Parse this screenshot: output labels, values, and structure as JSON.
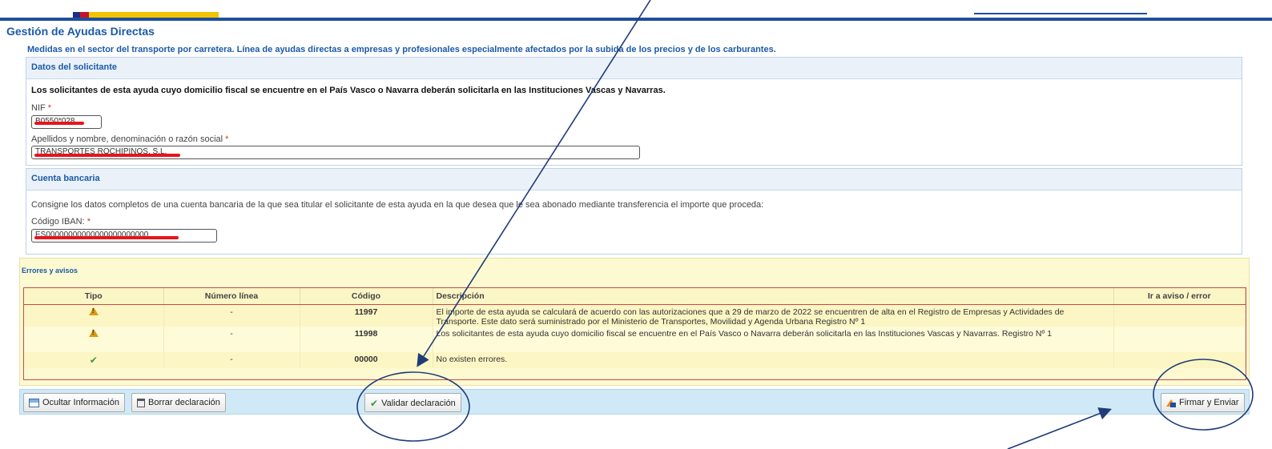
{
  "header": {
    "page_title": "Gestión de Ayudas Directas",
    "subtitle": "Medidas en el sector del transporte por carretera. Línea de ayudas directas a empresas y profesionales especialmente afectados por la subida de los precios y de los carburantes."
  },
  "solicitante": {
    "title": "Datos del solicitante",
    "note": "Los solicitantes de esta ayuda cuyo domicilio fiscal se encuentre en el País Vasco o Navarra deberán solicitarla en las Instituciones Vascas y Navarras.",
    "nif_label": "NIF",
    "nif_value": "B0550*028",
    "name_label": "Apellidos y nombre, denominación o razón social",
    "name_value": "TRANSPORTES ROCHIPINOS, S.L.",
    "required_mark": "*"
  },
  "cuenta": {
    "title": "Cuenta bancaria",
    "note": "Consigne los datos completos de una cuenta bancaria de la que sea titular el solicitante de esta ayuda en la que desea que le sea abonado mediante transferencia el importe que proceda:",
    "iban_label": "Código IBAN:",
    "iban_value": "ES00000000000000000000000",
    "required_mark": "*"
  },
  "errores": {
    "title": "Errores y avisos",
    "columns": [
      "Tipo",
      "Número línea",
      "Código",
      "Descripción",
      "Ir a aviso / error"
    ],
    "rows": [
      {
        "tipo_icon": "warning-icon",
        "linea": "-",
        "codigo": "11997",
        "descripcion": "El importe de esta ayuda se calculará de acuerdo con las autorizaciones que a 29 de marzo de 2022 se encuentren de alta en el Registro de Empresas y Actividades de Transporte. Este dato será suministrado por el Ministerio de Transportes, Movilidad y Agenda Urbana Registro Nº 1",
        "ir": ""
      },
      {
        "tipo_icon": "warning-icon",
        "linea": "-",
        "codigo": "11998",
        "descripcion": "Los solicitantes de esta ayuda cuyo domicilio fiscal se encuentre en el País Vasco o Navarra deberán solicitarla en las Instituciones Vascas y Navarras. Registro Nº 1",
        "ir": ""
      },
      {
        "tipo_icon": "check-icon",
        "linea": "-",
        "codigo": "00000",
        "descripcion": "No existen errores.",
        "ir": ""
      }
    ]
  },
  "toolbar": {
    "ocultar_label": "Ocultar Información",
    "borrar_label": "Borrar declaración",
    "validar_label": "Validar declaración",
    "firmar_label": "Firmar y Enviar"
  },
  "colors": {
    "brand_blue": "#1e4f9c",
    "title_blue": "#1b5aa8",
    "warning_panel": "#fdfad1",
    "toolbar_bg": "#cfe9f7",
    "annotation": "#1f3b7a",
    "redaction": "#e8141c"
  }
}
